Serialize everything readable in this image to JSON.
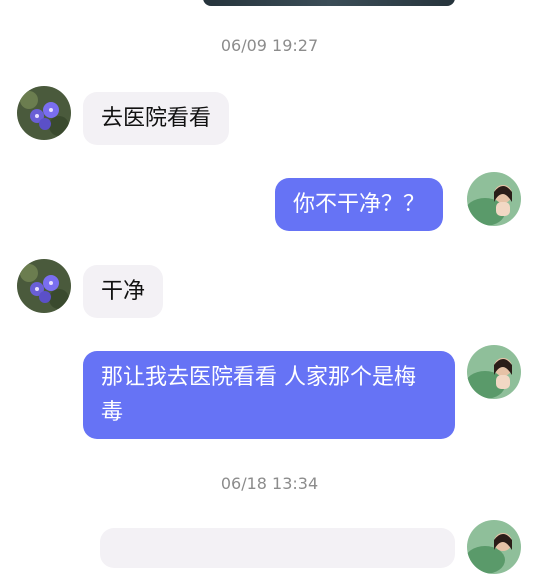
{
  "chat": {
    "messages": [
      {
        "type": "timestamp",
        "text": "06/09 19:27"
      },
      {
        "type": "incoming",
        "text": "去医院看看",
        "avatar": "flower-avatar"
      },
      {
        "type": "outgoing",
        "text": "你不干净？？",
        "avatar": "woman-avatar"
      },
      {
        "type": "incoming",
        "text": "干净",
        "avatar": "flower-avatar"
      },
      {
        "type": "outgoing",
        "text": "那让我去医院看看 人家那个是梅毒",
        "avatar": "woman-avatar"
      },
      {
        "type": "timestamp",
        "text": "06/18 13:34"
      }
    ]
  },
  "colors": {
    "outgoing_bubble": "#6673f5",
    "incoming_bubble": "#f3f1f5",
    "timestamp": "#8c8c8c"
  }
}
